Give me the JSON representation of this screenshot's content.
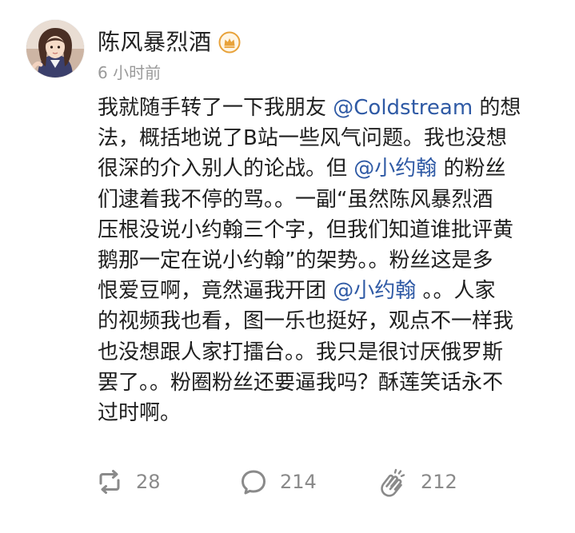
{
  "post": {
    "author": {
      "name": "陈风暴烈酒"
    },
    "badge": {
      "icon": "vip-crown-icon",
      "color": "#E8A23A"
    },
    "timestamp": "6 小时前",
    "content_lines": [
      [
        {
          "text": "我就随手转了一下我朋友 "
        },
        {
          "text": "@Coldstream",
          "mention": true
        },
        {
          "text": " 的想"
        }
      ],
      [
        {
          "text": "法，概括地说了B站一些风气问题。我也没想"
        }
      ],
      [
        {
          "text": "很深的介入别人的论战。但 "
        },
        {
          "text": "@小约翰",
          "mention": true
        },
        {
          "text": " 的粉丝"
        }
      ],
      [
        {
          "text": "们逮着我不停的骂。。一副“虽然陈风暴烈酒"
        }
      ],
      [
        {
          "text": "压根没说小约翰三个字，但我们知道谁批评黄"
        }
      ],
      [
        {
          "text": "鹅那一定在说小约翰”的架势。。粉丝这是多"
        }
      ],
      [
        {
          "text": "恨爱豆啊，竟然逼我开团 "
        },
        {
          "text": "@小约翰",
          "mention": true
        },
        {
          "text": " 。。人家"
        }
      ],
      [
        {
          "text": "的视频我也看，图一乐也挺好，观点不一样我"
        }
      ],
      [
        {
          "text": "也没想跟人家打擂台。。我只是很讨厌俄罗斯"
        }
      ],
      [
        {
          "text": "罢了。。粉圈粉丝还要逼我吗？酥莲笑话永不"
        }
      ],
      [
        {
          "text": "过时啊。"
        }
      ]
    ],
    "mention_color": "#2F5AA5",
    "actions": {
      "repost": {
        "icon": "repost-icon",
        "count": "28"
      },
      "comment": {
        "icon": "comment-icon",
        "count": "214"
      },
      "like": {
        "icon": "clap-like-icon",
        "count": "212"
      }
    }
  }
}
